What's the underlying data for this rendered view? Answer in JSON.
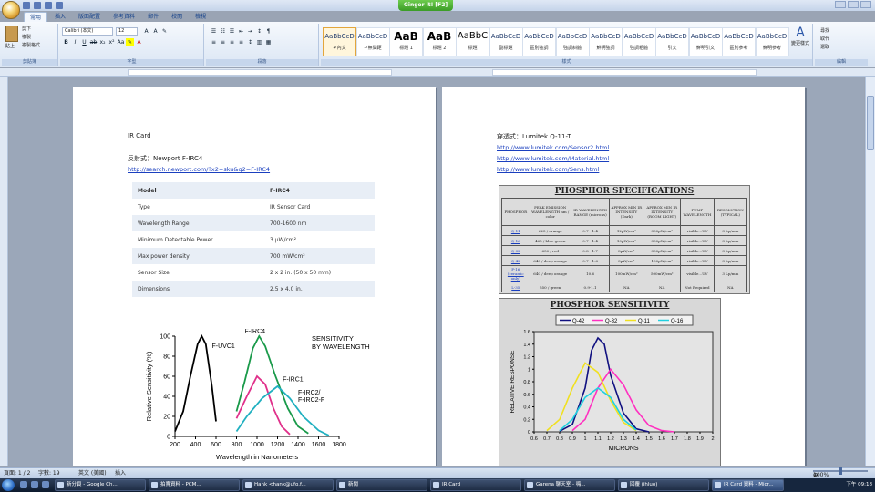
{
  "window": {
    "ginger_label": "Ginger it! [F2]"
  },
  "ribbon": {
    "tabs": [
      "常用",
      "插入",
      "版面配置",
      "參考資料",
      "郵件",
      "校閱",
      "檢視"
    ],
    "active_tab": 0,
    "clipboard": {
      "paste": "貼上",
      "cut": "剪下",
      "copy": "複製",
      "format_painter": "複製格式",
      "group": "剪貼簿"
    },
    "font": {
      "name": "Calibri (本文)",
      "size": "12",
      "group": "字型"
    },
    "paragraph_group": "段落",
    "styles_group": "樣式",
    "styles": [
      {
        "sample": "AaBbCcD",
        "name": "↵內文"
      },
      {
        "sample": "AaBbCcD",
        "name": "↵無間距"
      },
      {
        "sample": "AaB",
        "name": "標題 1"
      },
      {
        "sample": "AaB",
        "name": "標題 2"
      },
      {
        "sample": "AaBbC",
        "name": "標題"
      },
      {
        "sample": "AaBbCcD",
        "name": "副標題"
      },
      {
        "sample": "AaBbCcD",
        "name": "區別強調"
      },
      {
        "sample": "AaBbCcD",
        "name": "強調斜體"
      },
      {
        "sample": "AaBbCcD",
        "name": "鮮明強調"
      },
      {
        "sample": "AaBbCcD",
        "name": "強調粗體"
      },
      {
        "sample": "AaBbCcD",
        "name": "引文"
      },
      {
        "sample": "AaBbCcD",
        "name": "鮮明引文"
      },
      {
        "sample": "AaBbCcD",
        "name": "區別參考"
      },
      {
        "sample": "AaBbCcD",
        "name": "鮮明參考"
      }
    ],
    "change_styles": "變更樣式",
    "editing": {
      "find": "尋找",
      "replace": "取代",
      "select": "選取",
      "group": "編輯"
    }
  },
  "left_page": {
    "line1": "IR Card",
    "line2": "反射式：Newport F-IRC4",
    "link1": "http://search.newport.com/?x2=sku&q2=F-IRC4",
    "spec_table": [
      [
        "Model",
        "F-IRC4"
      ],
      [
        "Type",
        "IR Sensor Card"
      ],
      [
        "Wavelength Range",
        "700-1600 nm"
      ],
      [
        "Minimum Detectable Power",
        "3 μW/cm²"
      ],
      [
        "Max power density",
        "700 mW/cm²"
      ],
      [
        "Sensor Size",
        "2 x 2 in. (50 x 50 mm)"
      ],
      [
        "Dimensions",
        "2.5 x 4.0 in."
      ]
    ]
  },
  "sensitivity_chart": {
    "chart_data": {
      "type": "line",
      "title": "SENSITIVITY BY WAVELENGTH",
      "xlabel": "Wavelength in Nanometers",
      "ylabel": "Relative Sensitivity (%)",
      "xlim": [
        200,
        1800
      ],
      "ylim": [
        0,
        100
      ],
      "x_ticks": [
        200,
        400,
        600,
        800,
        1000,
        1200,
        1400,
        1600,
        1800
      ],
      "y_ticks": [
        0,
        20,
        40,
        60,
        80,
        100
      ],
      "series": [
        {
          "name": "F-UVC1",
          "color": "#000000",
          "points": [
            [
              200,
              5
            ],
            [
              280,
              25
            ],
            [
              350,
              60
            ],
            [
              420,
              92
            ],
            [
              460,
              100
            ],
            [
              500,
              92
            ],
            [
              560,
              50
            ],
            [
              600,
              15
            ]
          ]
        },
        {
          "name": "F-IRC4",
          "color": "#1a9a4a",
          "points": [
            [
              800,
              25
            ],
            [
              880,
              55
            ],
            [
              960,
              88
            ],
            [
              1020,
              100
            ],
            [
              1080,
              90
            ],
            [
              1180,
              60
            ],
            [
              1300,
              28
            ],
            [
              1400,
              10
            ],
            [
              1500,
              3
            ]
          ]
        },
        {
          "name": "F-IRC1",
          "color": "#e0308a",
          "points": [
            [
              800,
              18
            ],
            [
              900,
              40
            ],
            [
              1000,
              60
            ],
            [
              1080,
              52
            ],
            [
              1160,
              28
            ],
            [
              1240,
              10
            ],
            [
              1320,
              2
            ]
          ]
        },
        {
          "name": "F-IRC2/ F-IRC2-F",
          "color": "#20b0c0",
          "points": [
            [
              800,
              5
            ],
            [
              900,
              20
            ],
            [
              1050,
              38
            ],
            [
              1200,
              50
            ],
            [
              1320,
              38
            ],
            [
              1450,
              20
            ],
            [
              1600,
              6
            ],
            [
              1700,
              1
            ]
          ]
        }
      ]
    }
  },
  "right_page": {
    "line1": "穿透式：Lumitek Q-11-T",
    "links": [
      "http://www.lumitek.com/Sensor2.html",
      "http://www.lumitek.com/Material.html",
      "http://www.lumitek.com/Sens.html"
    ],
    "phosphor_title": "PHOSPHOR SPECIFICATIONS",
    "phosphor_headers": [
      "PHOSPHOR",
      "PEAK EMISSION WAVELENGTH nm / color",
      "IR WAVELENGTH RANGE (microns)",
      "APPROX MIN IR INTENSITY (Dark)",
      "APPROX MIN IR INTENSITY (ROOM LIGHT)",
      "PUMP WAVELENGTH",
      "RESOLUTION (TYPICAL)"
    ],
    "phosphor_rows": [
      [
        "Q-11",
        "625 / orange",
        "0.7 - 1.4",
        "12µW/cm²",
        "300µW/cm²",
        "visible...UV",
        "3 Lp/mm"
      ],
      [
        "Q-16",
        "465 / blue-green",
        "0.7 - 1.4",
        "10µW/cm²",
        "300µW/cm²",
        "visible...UV",
        "3 Lp/mm"
      ],
      [
        "Q-32",
        "650 / red",
        "0.8 - 1.7",
        "8µW/cm²",
        "300µW/cm²",
        "visible...UV",
        "3 Lp/mm"
      ],
      [
        "Q-42",
        "640 / deep orange",
        "0.7 - 1.6",
        "3µW/cm²",
        "100µW/cm²",
        "visible...UV",
        "3 Lp/mm"
      ],
      [
        "F-16 (ceramic only)",
        "640 / deep orange",
        "10.6",
        "100mW/cm²",
        "500mW/cm²",
        "visible...UV",
        "3 Lp/mm"
      ],
      [
        "L-35",
        "550 / green",
        "0.9-1.1",
        "NA",
        "NA",
        "Not Required",
        "NA"
      ]
    ],
    "sensitivity_title": "PHOSPHOR SENSITIVITY"
  },
  "phosphor_chart": {
    "chart_data": {
      "type": "line",
      "title": "",
      "xlabel": "MICRONS",
      "ylabel": "RELATIVE RESPONSE",
      "xlim": [
        0.6,
        2.0
      ],
      "ylim": [
        0,
        1.6
      ],
      "x_ticks": [
        "0.6",
        "0.7",
        "0.8",
        "0.9",
        "1",
        "1.1",
        "1.2",
        "1.3",
        "1.4",
        "1.5",
        "1.6",
        "1.7",
        "1.8",
        "1.9",
        "2"
      ],
      "y_ticks": [
        "0",
        "0.2",
        "0.4",
        "0.6",
        "0.8",
        "1",
        "1.2",
        "1.4",
        "1.6"
      ],
      "series": [
        {
          "name": "Q-42",
          "color": "#101080",
          "points": [
            [
              0.8,
              0.01
            ],
            [
              0.9,
              0.12
            ],
            [
              1.0,
              0.7
            ],
            [
              1.05,
              1.3
            ],
            [
              1.1,
              1.5
            ],
            [
              1.15,
              1.4
            ],
            [
              1.2,
              0.9
            ],
            [
              1.3,
              0.3
            ],
            [
              1.4,
              0.05
            ],
            [
              1.5,
              0.0
            ]
          ]
        },
        {
          "name": "Q-32",
          "color": "#ff30c0",
          "points": [
            [
              0.9,
              0.02
            ],
            [
              1.0,
              0.2
            ],
            [
              1.1,
              0.7
            ],
            [
              1.2,
              1.0
            ],
            [
              1.3,
              0.75
            ],
            [
              1.4,
              0.35
            ],
            [
              1.5,
              0.1
            ],
            [
              1.6,
              0.02
            ],
            [
              1.7,
              0.0
            ]
          ]
        },
        {
          "name": "Q-11",
          "color": "#f0e020",
          "points": [
            [
              0.7,
              0.02
            ],
            [
              0.8,
              0.2
            ],
            [
              0.9,
              0.7
            ],
            [
              1.0,
              1.1
            ],
            [
              1.1,
              0.95
            ],
            [
              1.2,
              0.5
            ],
            [
              1.3,
              0.15
            ],
            [
              1.4,
              0.02
            ]
          ]
        },
        {
          "name": "Q-16",
          "color": "#20d0e0",
          "points": [
            [
              0.8,
              0.02
            ],
            [
              0.9,
              0.2
            ],
            [
              1.0,
              0.55
            ],
            [
              1.1,
              0.7
            ],
            [
              1.2,
              0.55
            ],
            [
              1.3,
              0.2
            ],
            [
              1.4,
              0.03
            ]
          ]
        }
      ]
    }
  },
  "status_bar": {
    "page": "頁面: 1 / 2",
    "words": "字數: 19",
    "language": "英文 (美國)",
    "mode": "插入",
    "zoom": "100%"
  },
  "taskbar": {
    "buttons": [
      "新分頁 - Google Ch...",
      "拍賣資料 - PCM...",
      "Hank <hank@ufo.f...",
      "新聞",
      "IR Card",
      "Garena 聊天室 - 嗨...",
      "回覆 (ihluo)",
      "IR Card 資料 - Micr..."
    ],
    "active": 7,
    "clock": "下午 09:18"
  }
}
